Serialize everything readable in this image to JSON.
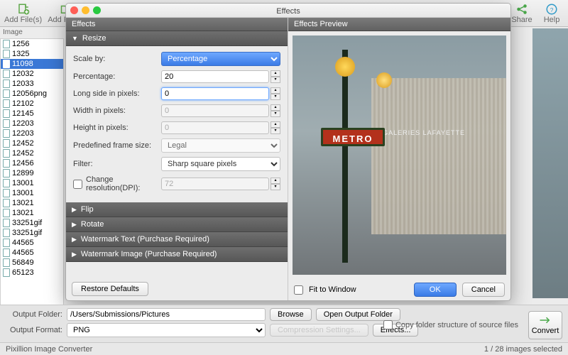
{
  "toolbar": {
    "add_files": "Add File(s)",
    "add_folder": "Add Folder",
    "share": "Share",
    "help": "Help"
  },
  "sidebar": {
    "header": "Image",
    "items": [
      "1256",
      "1325",
      "11098",
      "12032",
      "12033",
      "12056png",
      "12102",
      "12145",
      "12203",
      "12203",
      "12452",
      "12452",
      "12456",
      "12899",
      "13001",
      "13001",
      "13021",
      "13021",
      "33251gif",
      "33251gif",
      "44565",
      "44565",
      "56849",
      "65123"
    ],
    "selected_index": 2
  },
  "dialog": {
    "title": "Effects",
    "effects_header": "Effects",
    "preview_header": "Effects Preview",
    "sections": {
      "resize": "Resize",
      "flip": "Flip",
      "rotate": "Rotate",
      "watermark_text": "Watermark Text (Purchase Required)",
      "watermark_image": "Watermark Image (Purchase Required)"
    },
    "resize_form": {
      "scale_by_label": "Scale by:",
      "scale_by_value": "Percentage",
      "percentage_label": "Percentage:",
      "percentage_value": "20",
      "long_side_label": "Long side in pixels:",
      "long_side_value": "0",
      "width_label": "Width in pixels:",
      "width_value": "0",
      "height_label": "Height in pixels:",
      "height_value": "0",
      "predefined_label": "Predefined frame size:",
      "predefined_value": "Legal",
      "filter_label": "Filter:",
      "filter_value": "Sharp square pixels",
      "change_res_label": "Change resolution(DPI):",
      "change_res_value": "72"
    },
    "restore_defaults": "Restore Defaults",
    "fit_to_window": "Fit to Window",
    "ok": "OK",
    "cancel": "Cancel",
    "preview_sign": "METRO",
    "preview_store": "GALERIES LAFAYETTE"
  },
  "bottom": {
    "output_folder_label": "Output Folder:",
    "output_folder_value": "/Users/Submissions/Pictures",
    "browse": "Browse",
    "open_output_folder": "Open Output Folder",
    "output_format_label": "Output Format:",
    "output_format_value": "PNG",
    "compression_settings": "Compression Settings...",
    "effects_btn": "Effects...",
    "copy_folder_structure": "Copy folder structure of source files",
    "convert": "Convert"
  },
  "status": {
    "app_name": "Pixillion Image Converter",
    "selection": "1 / 28 images selected"
  }
}
